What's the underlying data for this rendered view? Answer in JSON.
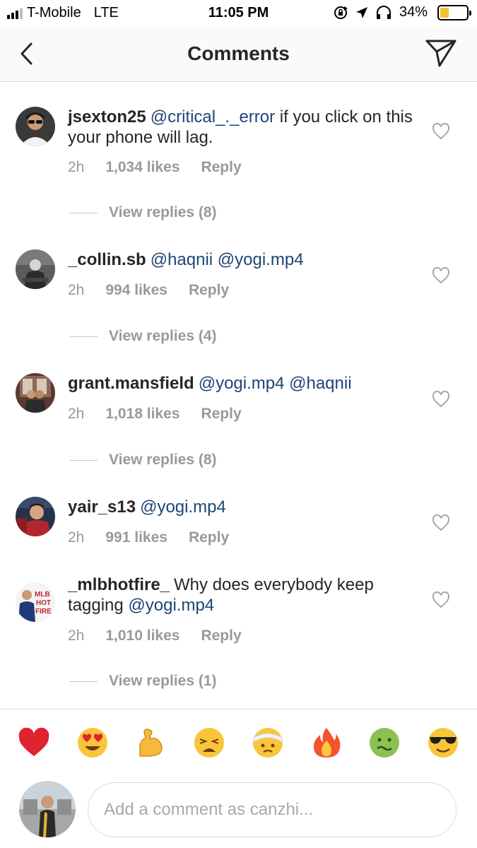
{
  "status_bar": {
    "carrier": "T-Mobile",
    "network": "LTE",
    "time": "11:05 PM",
    "battery_percent": "34%",
    "battery_level": 0.34,
    "signal_bars": 3,
    "icons": [
      "rotation-lock-icon",
      "location-arrow-icon",
      "headphones-icon",
      "battery-icon"
    ],
    "battery_color": "#f2c230"
  },
  "header": {
    "title": "Comments",
    "back_icon": "chevron-left-icon",
    "send_icon": "paper-plane-icon"
  },
  "comments": [
    {
      "username": "jsexton25",
      "mention": "@critical_._error",
      "text": " if you click on this your phone will lag.",
      "time": "2h",
      "likes": "1,034 likes",
      "reply": "Reply",
      "view_replies": "View replies (8)"
    },
    {
      "username": "_collin.sb",
      "mention": "@haqnii @yogi.mp4",
      "text": "",
      "time": "2h",
      "likes": "994 likes",
      "reply": "Reply",
      "view_replies": "View replies (4)"
    },
    {
      "username": "grant.mansfield",
      "mention": "@yogi.mp4 @haqnii",
      "text": "",
      "time": "2h",
      "likes": "1,018 likes",
      "reply": "Reply",
      "view_replies": "View replies (8)"
    },
    {
      "username": "yair_s13",
      "mention": "@yogi.mp4",
      "text": "",
      "time": "2h",
      "likes": "991 likes",
      "reply": "Reply",
      "view_replies": ""
    },
    {
      "username": "_mlbhotfire_",
      "text_before": "Why does everybody keep tagging ",
      "mention": "@yogi.mp4",
      "time": "2h",
      "likes": "1,010 likes",
      "reply": "Reply",
      "view_replies": "View replies (1)"
    }
  ],
  "emoji_bar": [
    "❤️",
    "😍",
    "💪",
    "😩",
    "🤕",
    "🔥",
    "🤢",
    "😎"
  ],
  "composer": {
    "placeholder": "Add a comment as canzhi..."
  },
  "colors": {
    "mention": "#1d4577",
    "meta_gray": "#999999",
    "divider": "#dbdbdb"
  }
}
